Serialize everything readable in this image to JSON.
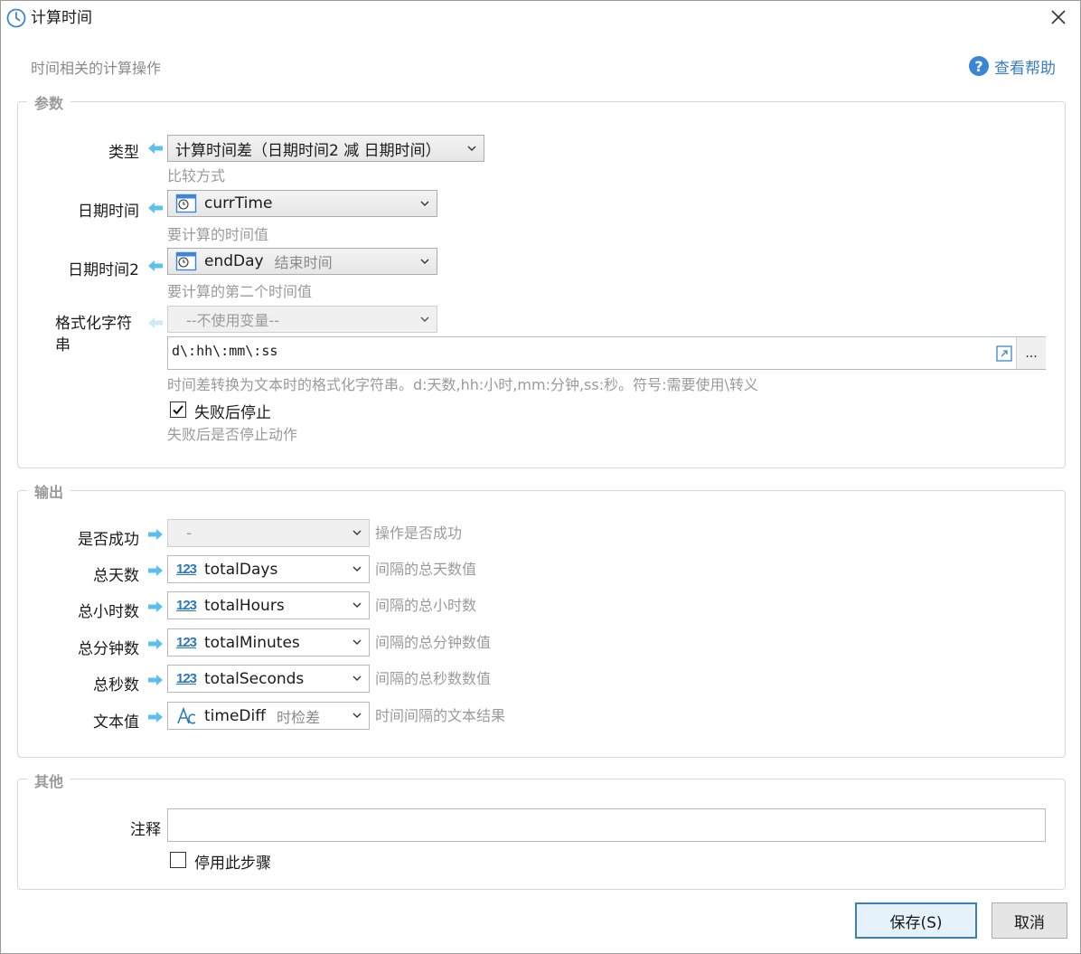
{
  "window": {
    "title": "计算时间",
    "subtitle": "时间相关的计算操作",
    "help_label": "查看帮助"
  },
  "params": {
    "group_title": "参数",
    "type": {
      "label": "类型",
      "value": "计算时间差（日期时间2 减 日期时间）",
      "hint": "比较方式"
    },
    "datetime1": {
      "label": "日期时间",
      "value": "currTime",
      "hint": "要计算的时间值"
    },
    "datetime2": {
      "label": "日期时间2",
      "value": "endDay",
      "sub": "结束时间",
      "hint": "要计算的第二个时间值"
    },
    "format": {
      "label": "格式化字符串",
      "variable": "--不使用变量--",
      "value": "d\\:hh\\:mm\\:ss",
      "more_label": "...",
      "hint": "时间差转换为文本时的格式化字符串。d:天数,hh:小时,mm:分钟,ss:秒。符号:需要使用\\转义"
    },
    "stop_on_fail": {
      "label": "失败后停止",
      "checked": true,
      "hint": "失败后是否停止动作"
    }
  },
  "output": {
    "group_title": "输出",
    "rows": [
      {
        "label": "是否成功",
        "value": "-",
        "hint": "操作是否成功",
        "icon": "none"
      },
      {
        "label": "总天数",
        "value": "totalDays",
        "hint": "间隔的总天数值",
        "icon": "number-icon"
      },
      {
        "label": "总小时数",
        "value": "totalHours",
        "hint": "间隔的总小时数",
        "icon": "number-icon"
      },
      {
        "label": "总分钟数",
        "value": "totalMinutes",
        "hint": "间隔的总分钟数值",
        "icon": "number-icon"
      },
      {
        "label": "总秒数",
        "value": "totalSeconds",
        "hint": "间隔的总秒数数值",
        "icon": "number-icon"
      },
      {
        "label": "文本值",
        "value": "timeDiff",
        "sub": "时检差",
        "hint": "时间间隔的文本结果",
        "icon": "text-icon"
      }
    ],
    "number_glyph": "123"
  },
  "other": {
    "group_title": "其他",
    "comment_label": "注释",
    "comment_value": "",
    "disable_label": "停用此步骤",
    "disable_checked": false
  },
  "buttons": {
    "save": "保存(S)",
    "cancel": "取消"
  },
  "colors": {
    "arrow": "#5bc0f0",
    "primary_border": "#3c7fb1",
    "help": "#3a86d4"
  }
}
